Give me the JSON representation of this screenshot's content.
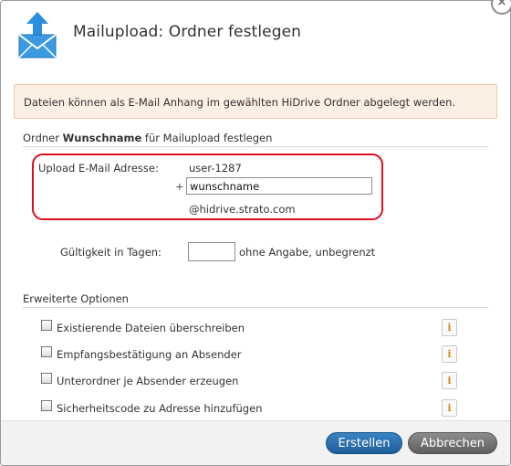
{
  "dialog": {
    "title": "Mailupload: Ordner festlegen",
    "close_glyph": "×",
    "logo_icon": "mail-upload-icon"
  },
  "notice": {
    "text": "Dateien können als E-Mail Anhang im gewählten HiDrive Ordner abgelegt werden."
  },
  "section_name": {
    "prefix": "Ordner ",
    "bold": "Wunschname",
    "suffix": " für Mailupload festlegen"
  },
  "email": {
    "label": "Upload E-Mail Adresse:",
    "user": "user-1287",
    "plus": "+",
    "value": "wunschname",
    "domain": "@hidrive.strato.com"
  },
  "validity": {
    "label": "Gültigkeit in Tagen:",
    "value": "",
    "hint": "ohne Angabe, unbegrenzt"
  },
  "advanced": {
    "title": "Erweiterte Optionen",
    "options": [
      {
        "label": "Existierende Dateien überschreiben",
        "checked": false
      },
      {
        "label": "Empfangsbestätigung an Absender",
        "checked": false
      },
      {
        "label": "Unterordner je Absender erzeugen",
        "checked": false
      },
      {
        "label": "Sicherheitscode zu Adresse hinzufügen",
        "checked": false
      }
    ],
    "info_glyph": "i"
  },
  "buttons": {
    "create": "Erstellen",
    "cancel": "Abbrechen"
  },
  "colors": {
    "highlight": "#e00d1d",
    "notice_bg": "#fcefe3",
    "primary": "#1e5e99",
    "secondary": "#6a6a6a"
  }
}
